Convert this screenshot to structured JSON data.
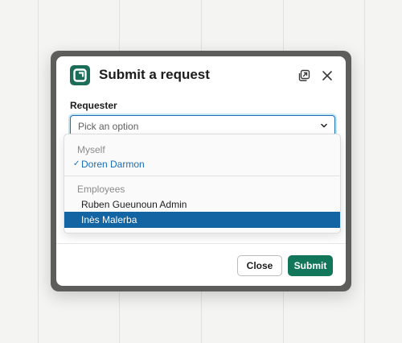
{
  "modal": {
    "title": "Submit a request",
    "requester_label": "Requester",
    "select_placeholder": "Pick an option",
    "close_label": "Close",
    "submit_label": "Submit"
  },
  "dropdown": {
    "groups": [
      {
        "label": "Myself",
        "options": [
          {
            "label": "Doren Darmon",
            "checked": true
          }
        ]
      },
      {
        "label": "Employees",
        "options": [
          {
            "label": "Ruben Gueunoun Admin",
            "highlighted": false
          },
          {
            "label": "Inès Malerba",
            "highlighted": true
          }
        ]
      }
    ]
  },
  "colors": {
    "accent": "#1264a3",
    "submit_green": "#12775a",
    "logo_green": "#1c6c5a"
  },
  "icons": [
    "app-logo-icon",
    "open-in-new-window-icon",
    "close-icon",
    "chevron-down-icon",
    "check-icon"
  ]
}
